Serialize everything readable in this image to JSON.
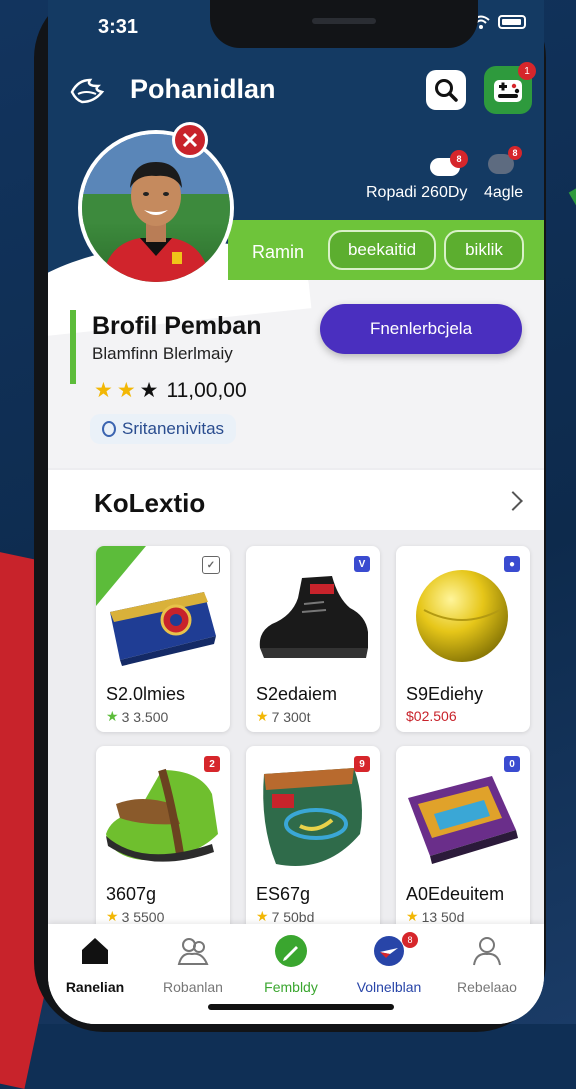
{
  "status_bar": {
    "time": "3:31"
  },
  "header": {
    "title": "Pohanidlan",
    "search_icon": "search-icon",
    "game_icon": "gamepad-icon",
    "notification_badge": "1"
  },
  "stats": {
    "left_badge": "8",
    "right_badge": "8",
    "left_label": "Ropadi 260Dy",
    "right_label": "4agle"
  },
  "tabs": {
    "plain": "Ramin",
    "chip1": "beekaitid",
    "chip2": "biklik"
  },
  "profile": {
    "name": "Brofil Pemban",
    "subtitle": "Blamfinn Blerlmaiy",
    "rating": "11,00,00",
    "stars_filled": 2,
    "stars_total": 3,
    "tag": "Sritanenivitas",
    "action_button": "Fnenlerbcjela"
  },
  "collection": {
    "title": "KoLextio",
    "items": [
      {
        "name": "S2.0lmies",
        "price": "3 3.500",
        "price_style": "green",
        "badge": "",
        "badge_color": "#ffffff",
        "image": "bag"
      },
      {
        "name": "S2edaiem",
        "price": "7 300t",
        "price_style": "gold",
        "badge": "V",
        "badge_color": "#3a4bd0",
        "image": "boot"
      },
      {
        "name": "S9Ediehy",
        "price": "$02.506",
        "price_style": "red",
        "badge": "●",
        "badge_color": "#3a4bd0",
        "image": "ball"
      },
      {
        "name": "3607g",
        "price": "3 5500",
        "price_style": "gold",
        "badge": "2",
        "badge_color": "#d6262b",
        "image": "shoe"
      },
      {
        "name": "ES67g",
        "price": "7 50bd",
        "price_style": "gold",
        "badge": "9",
        "badge_color": "#d6262b",
        "image": "pouch"
      },
      {
        "name": "A0Edeuitem",
        "price": "13 50d",
        "price_style": "gold",
        "badge": "0",
        "badge_color": "#3a4bd0",
        "image": "wallet"
      }
    ]
  },
  "bottom_nav": [
    {
      "label": "Ranelian",
      "icon": "home-icon",
      "active": true,
      "color": "#111111"
    },
    {
      "label": "Robanlan",
      "icon": "people-icon",
      "active": false,
      "color": "#777777"
    },
    {
      "label": "Fembldy",
      "icon": "pencil-icon",
      "active": false,
      "color": "#3aa62f"
    },
    {
      "label": "Volnelblan",
      "icon": "compass-icon",
      "active": false,
      "color": "#2845a8",
      "badge": "8"
    },
    {
      "label": "Rebelaao",
      "icon": "profile-icon",
      "active": false,
      "color": "#777777"
    }
  ],
  "colors": {
    "header": "#143a63",
    "accent_green": "#6ec43a",
    "accent_purple": "#4a2fbf",
    "badge_red": "#d6262b"
  }
}
